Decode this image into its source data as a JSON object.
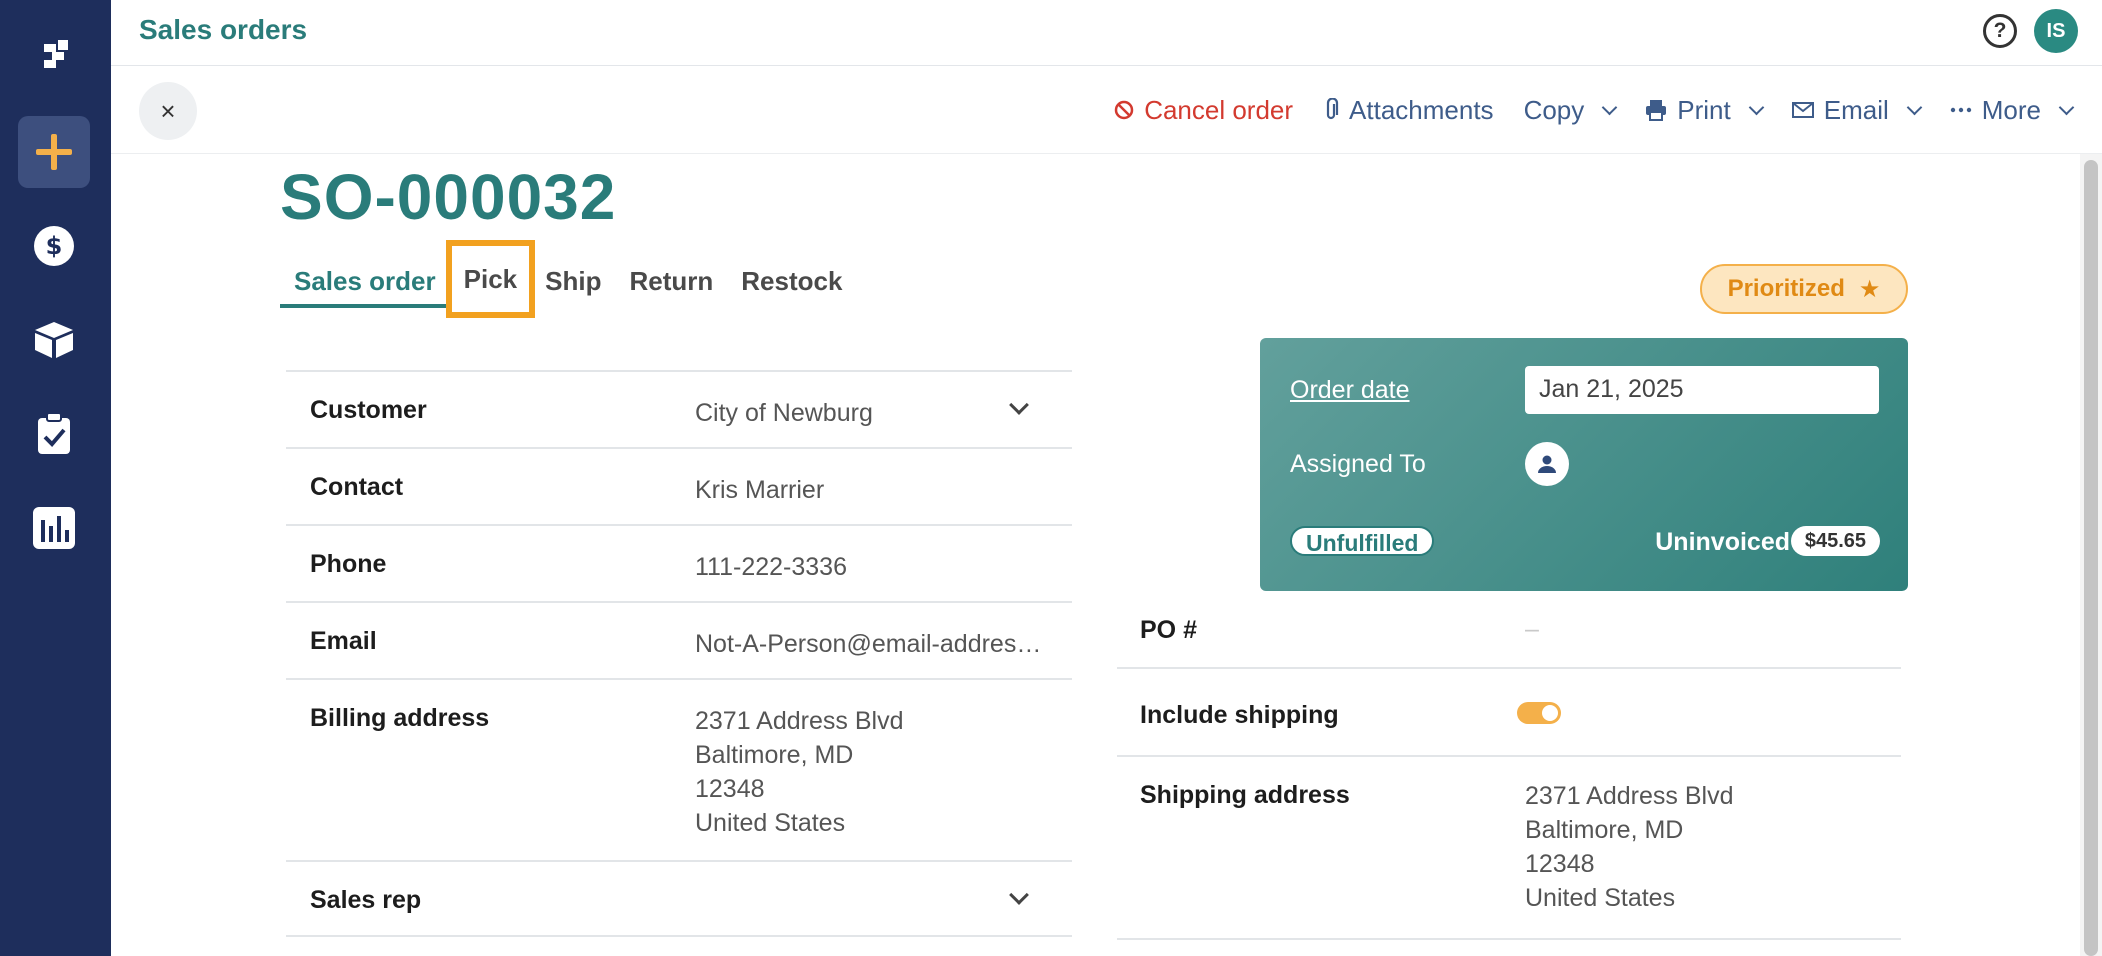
{
  "app": {
    "title": "Sales orders",
    "help_icon": "?",
    "avatar_initials": "IS"
  },
  "sidebar": {
    "items": [
      {
        "icon": "logo-icon"
      },
      {
        "icon": "plus-icon",
        "active": true
      },
      {
        "icon": "dollar-icon"
      },
      {
        "icon": "box-icon"
      },
      {
        "icon": "clipboard-check-icon"
      },
      {
        "icon": "bar-chart-icon"
      }
    ]
  },
  "actionbar": {
    "close_label": "×",
    "cancel_order": "Cancel order",
    "attachments": "Attachments",
    "copy": "Copy",
    "print": "Print",
    "email": "Email",
    "more": "More"
  },
  "order": {
    "number": "SO-000032",
    "priority_badge": "Prioritized",
    "priority_star": "★"
  },
  "tabs": [
    {
      "label": "Sales order",
      "active": true
    },
    {
      "label": "Pick",
      "highlighted": true
    },
    {
      "label": "Ship"
    },
    {
      "label": "Return"
    },
    {
      "label": "Restock"
    }
  ],
  "details": {
    "customer_label": "Customer",
    "customer_value": "City of Newburg",
    "contact_label": "Contact",
    "contact_value": "Kris Marrier",
    "phone_label": "Phone",
    "phone_value": "111-222-3336",
    "email_label": "Email",
    "email_value": "Not-A-Person@email-addres…",
    "billing_label": "Billing address",
    "billing_lines": [
      "2371 Address Blvd",
      "Baltimore, MD",
      "12348",
      "United States"
    ],
    "sales_rep_label": "Sales rep"
  },
  "status": {
    "order_date_label": "Order date",
    "order_date_value": "Jan 21, 2025",
    "assigned_to_label": "Assigned To",
    "fulfillment_badge": "Unfulfilled",
    "invoice_status": "Uninvoiced",
    "invoice_amount": "$45.65"
  },
  "right_details": {
    "po_label": "PO #",
    "po_value": "–",
    "include_shipping_label": "Include shipping",
    "include_shipping_on": true,
    "shipping_label": "Shipping address",
    "shipping_lines": [
      "2371 Address Blvd",
      "Baltimore, MD",
      "12348",
      "United States"
    ]
  },
  "colors": {
    "sidebar": "#1e2e5c",
    "accent": "#2a7c7a",
    "danger": "#d33a2f",
    "warning": "#f4b04a",
    "highlight": "#f2a11f"
  }
}
